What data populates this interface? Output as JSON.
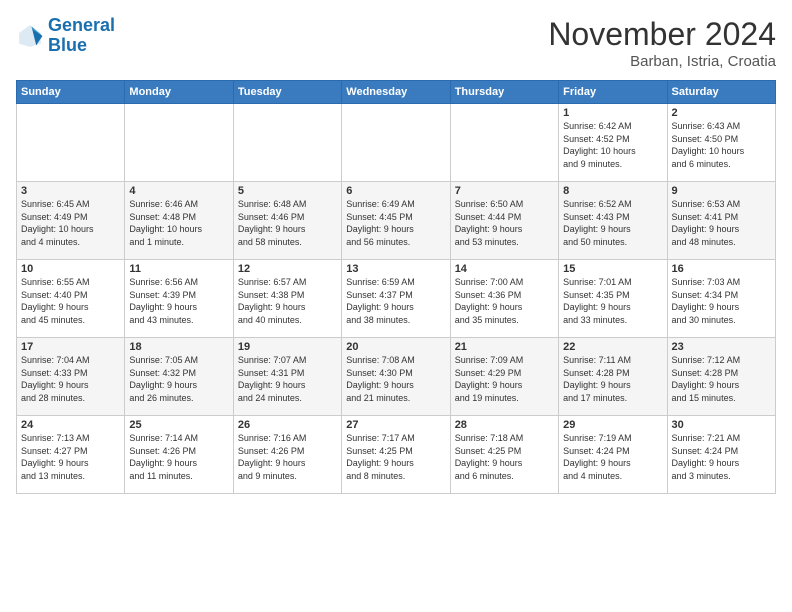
{
  "logo": {
    "line1": "General",
    "line2": "Blue"
  },
  "title": "November 2024",
  "location": "Barban, Istria, Croatia",
  "days_of_week": [
    "Sunday",
    "Monday",
    "Tuesday",
    "Wednesday",
    "Thursday",
    "Friday",
    "Saturday"
  ],
  "weeks": [
    [
      {
        "day": "",
        "info": ""
      },
      {
        "day": "",
        "info": ""
      },
      {
        "day": "",
        "info": ""
      },
      {
        "day": "",
        "info": ""
      },
      {
        "day": "",
        "info": ""
      },
      {
        "day": "1",
        "info": "Sunrise: 6:42 AM\nSunset: 4:52 PM\nDaylight: 10 hours\nand 9 minutes."
      },
      {
        "day": "2",
        "info": "Sunrise: 6:43 AM\nSunset: 4:50 PM\nDaylight: 10 hours\nand 6 minutes."
      }
    ],
    [
      {
        "day": "3",
        "info": "Sunrise: 6:45 AM\nSunset: 4:49 PM\nDaylight: 10 hours\nand 4 minutes."
      },
      {
        "day": "4",
        "info": "Sunrise: 6:46 AM\nSunset: 4:48 PM\nDaylight: 10 hours\nand 1 minute."
      },
      {
        "day": "5",
        "info": "Sunrise: 6:48 AM\nSunset: 4:46 PM\nDaylight: 9 hours\nand 58 minutes."
      },
      {
        "day": "6",
        "info": "Sunrise: 6:49 AM\nSunset: 4:45 PM\nDaylight: 9 hours\nand 56 minutes."
      },
      {
        "day": "7",
        "info": "Sunrise: 6:50 AM\nSunset: 4:44 PM\nDaylight: 9 hours\nand 53 minutes."
      },
      {
        "day": "8",
        "info": "Sunrise: 6:52 AM\nSunset: 4:43 PM\nDaylight: 9 hours\nand 50 minutes."
      },
      {
        "day": "9",
        "info": "Sunrise: 6:53 AM\nSunset: 4:41 PM\nDaylight: 9 hours\nand 48 minutes."
      }
    ],
    [
      {
        "day": "10",
        "info": "Sunrise: 6:55 AM\nSunset: 4:40 PM\nDaylight: 9 hours\nand 45 minutes."
      },
      {
        "day": "11",
        "info": "Sunrise: 6:56 AM\nSunset: 4:39 PM\nDaylight: 9 hours\nand 43 minutes."
      },
      {
        "day": "12",
        "info": "Sunrise: 6:57 AM\nSunset: 4:38 PM\nDaylight: 9 hours\nand 40 minutes."
      },
      {
        "day": "13",
        "info": "Sunrise: 6:59 AM\nSunset: 4:37 PM\nDaylight: 9 hours\nand 38 minutes."
      },
      {
        "day": "14",
        "info": "Sunrise: 7:00 AM\nSunset: 4:36 PM\nDaylight: 9 hours\nand 35 minutes."
      },
      {
        "day": "15",
        "info": "Sunrise: 7:01 AM\nSunset: 4:35 PM\nDaylight: 9 hours\nand 33 minutes."
      },
      {
        "day": "16",
        "info": "Sunrise: 7:03 AM\nSunset: 4:34 PM\nDaylight: 9 hours\nand 30 minutes."
      }
    ],
    [
      {
        "day": "17",
        "info": "Sunrise: 7:04 AM\nSunset: 4:33 PM\nDaylight: 9 hours\nand 28 minutes."
      },
      {
        "day": "18",
        "info": "Sunrise: 7:05 AM\nSunset: 4:32 PM\nDaylight: 9 hours\nand 26 minutes."
      },
      {
        "day": "19",
        "info": "Sunrise: 7:07 AM\nSunset: 4:31 PM\nDaylight: 9 hours\nand 24 minutes."
      },
      {
        "day": "20",
        "info": "Sunrise: 7:08 AM\nSunset: 4:30 PM\nDaylight: 9 hours\nand 21 minutes."
      },
      {
        "day": "21",
        "info": "Sunrise: 7:09 AM\nSunset: 4:29 PM\nDaylight: 9 hours\nand 19 minutes."
      },
      {
        "day": "22",
        "info": "Sunrise: 7:11 AM\nSunset: 4:28 PM\nDaylight: 9 hours\nand 17 minutes."
      },
      {
        "day": "23",
        "info": "Sunrise: 7:12 AM\nSunset: 4:28 PM\nDaylight: 9 hours\nand 15 minutes."
      }
    ],
    [
      {
        "day": "24",
        "info": "Sunrise: 7:13 AM\nSunset: 4:27 PM\nDaylight: 9 hours\nand 13 minutes."
      },
      {
        "day": "25",
        "info": "Sunrise: 7:14 AM\nSunset: 4:26 PM\nDaylight: 9 hours\nand 11 minutes."
      },
      {
        "day": "26",
        "info": "Sunrise: 7:16 AM\nSunset: 4:26 PM\nDaylight: 9 hours\nand 9 minutes."
      },
      {
        "day": "27",
        "info": "Sunrise: 7:17 AM\nSunset: 4:25 PM\nDaylight: 9 hours\nand 8 minutes."
      },
      {
        "day": "28",
        "info": "Sunrise: 7:18 AM\nSunset: 4:25 PM\nDaylight: 9 hours\nand 6 minutes."
      },
      {
        "day": "29",
        "info": "Sunrise: 7:19 AM\nSunset: 4:24 PM\nDaylight: 9 hours\nand 4 minutes."
      },
      {
        "day": "30",
        "info": "Sunrise: 7:21 AM\nSunset: 4:24 PM\nDaylight: 9 hours\nand 3 minutes."
      }
    ]
  ]
}
